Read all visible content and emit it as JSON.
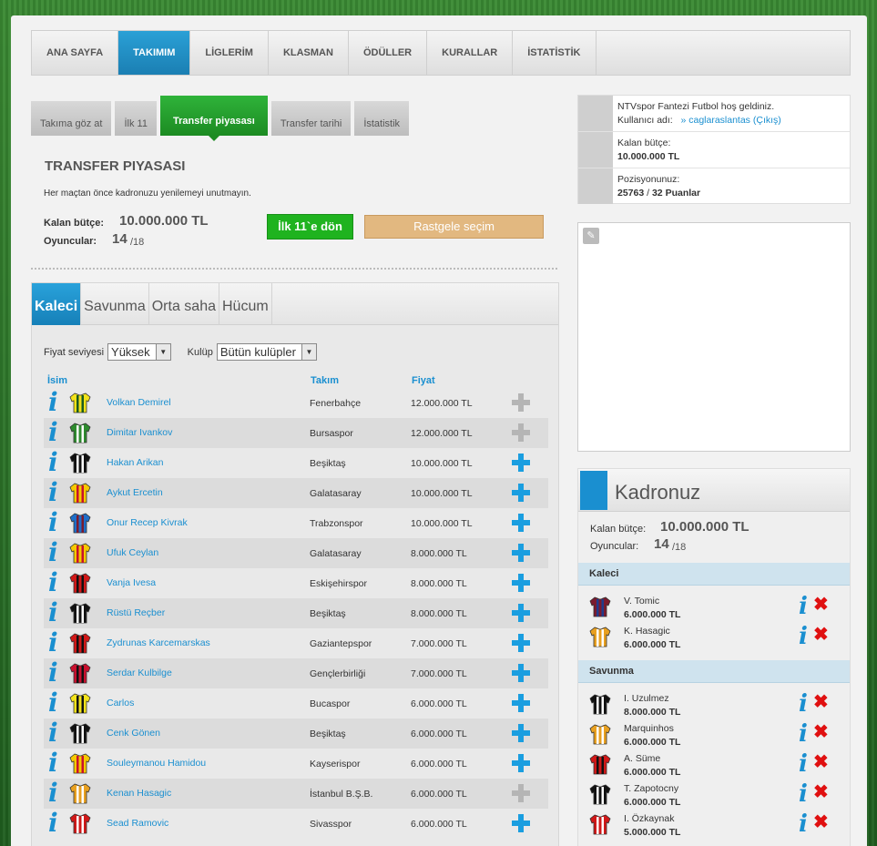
{
  "topnav": [
    "ANA SAYFA",
    "TAKIMIM",
    "LİGLERİM",
    "KLASMAN",
    "ÖDÜLLER",
    "KURALLAR",
    "İSTATİSTİK"
  ],
  "subnav": [
    "Takıma göz at",
    "İlk 11",
    "Transfer piyasası",
    "Transfer tarihi",
    "İstatistik"
  ],
  "header": {
    "title": "TRANSFER PIYASASI",
    "note": "Her maçtan önce kadronuzu yenilemeyi unutmayın.",
    "budget_label": "Kalan bütçe:",
    "budget_value": "10.000.000 TL",
    "players_label": "Oyuncular:",
    "players_value": "14",
    "players_max": "/18",
    "btn_first11": "İlk 11`e dön",
    "btn_random": "Rastgele seçim"
  },
  "position_tabs": [
    "Kaleci",
    "Savunma",
    "Orta saha",
    "Hücum"
  ],
  "filters": {
    "price_label": "Fiyat seviyesi",
    "price_value": "Yüksek",
    "club_label": "Kulüp",
    "club_value": "Bütün kulüpler"
  },
  "table": {
    "col_name": "İsim",
    "col_club": "Takım",
    "col_price": "Fiyat",
    "rows": [
      {
        "name": "Volkan Demirel",
        "club": "Fenerbahçe",
        "price": "12.000.000 TL",
        "avail": false,
        "c1": "#f2e21a",
        "c2": "#1a5a20"
      },
      {
        "name": "Dimitar Ivankov",
        "club": "Bursaspor",
        "price": "12.000.000 TL",
        "avail": false,
        "c1": "#2e8b2e",
        "c2": "#ffffff"
      },
      {
        "name": "Hakan Arikan",
        "club": "Beşiktaş",
        "price": "10.000.000 TL",
        "avail": true,
        "c1": "#111111",
        "c2": "#ffffff"
      },
      {
        "name": "Aykut Ercetin",
        "club": "Galatasaray",
        "price": "10.000.000 TL",
        "avail": true,
        "c1": "#f5c800",
        "c2": "#c8102e"
      },
      {
        "name": "Onur Recep Kivrak",
        "club": "Trabzonspor",
        "price": "10.000.000 TL",
        "avail": true,
        "c1": "#1e6ec8",
        "c2": "#7a1b2e"
      },
      {
        "name": "Ufuk Ceylan",
        "club": "Galatasaray",
        "price": "8.000.000 TL",
        "avail": true,
        "c1": "#f5c800",
        "c2": "#c8102e"
      },
      {
        "name": "Vanja Ivesa",
        "club": "Eskişehirspor",
        "price": "8.000.000 TL",
        "avail": true,
        "c1": "#d01818",
        "c2": "#111111"
      },
      {
        "name": "Rüstü Reçber",
        "club": "Beşiktaş",
        "price": "8.000.000 TL",
        "avail": true,
        "c1": "#111111",
        "c2": "#ffffff"
      },
      {
        "name": "Zydrunas Karcemarskas",
        "club": "Gaziantepspor",
        "price": "7.000.000 TL",
        "avail": true,
        "c1": "#d01818",
        "c2": "#111111"
      },
      {
        "name": "Serdar Kulbilge",
        "club": "Gençlerbirliği",
        "price": "7.000.000 TL",
        "avail": true,
        "c1": "#c8102e",
        "c2": "#111111"
      },
      {
        "name": "Carlos",
        "club": "Bucaspor",
        "price": "6.000.000 TL",
        "avail": true,
        "c1": "#f2e21a",
        "c2": "#111111"
      },
      {
        "name": "Cenk Gönen",
        "club": "Beşiktaş",
        "price": "6.000.000 TL",
        "avail": true,
        "c1": "#111111",
        "c2": "#ffffff"
      },
      {
        "name": "Souleymanou Hamidou",
        "club": "Kayserispor",
        "price": "6.000.000 TL",
        "avail": true,
        "c1": "#f5c800",
        "c2": "#c8102e"
      },
      {
        "name": "Kenan Hasagic",
        "club": "İstanbul B.Ş.B.",
        "price": "6.000.000 TL",
        "avail": false,
        "c1": "#e8a020",
        "c2": "#ffffff"
      },
      {
        "name": "Sead Ramovic",
        "club": "Sivasspor",
        "price": "6.000.000 TL",
        "avail": true,
        "c1": "#d01818",
        "c2": "#ffffff"
      }
    ]
  },
  "user": {
    "welcome": "NTVspor Fantezi Futbol hoş geldiniz.",
    "user_label": "Kullanıcı adı:",
    "username": "» caglaraslantas",
    "logout": "(Çıkış)",
    "budget_label": "Kalan bütçe:",
    "budget_value": "10.000.000 TL",
    "pos_label": "Pozisyonunuz:",
    "pos_value": "25763",
    "pos_sep": "/",
    "pos_points": "32 Puanlar"
  },
  "squad": {
    "title": "Kadronuz",
    "budget_label": "Kalan bütçe:",
    "budget_value": "10.000.000 TL",
    "players_label": "Oyuncular:",
    "players_value": "14",
    "players_max": "/18",
    "sec_gk": "Kaleci",
    "sec_def": "Savunma",
    "gk": [
      {
        "name": "V. Tomic",
        "price": "6.000.000 TL",
        "c1": "#7a1b2e",
        "c2": "#1e3c8c"
      },
      {
        "name": "K. Hasagic",
        "price": "6.000.000 TL",
        "c1": "#e8a020",
        "c2": "#ffffff"
      }
    ],
    "def": [
      {
        "name": "I. Uzulmez",
        "price": "8.000.000 TL",
        "c1": "#111111",
        "c2": "#ffffff"
      },
      {
        "name": "Marquinhos",
        "price": "6.000.000 TL",
        "c1": "#e8a020",
        "c2": "#ffffff"
      },
      {
        "name": "A. Süme",
        "price": "6.000.000 TL",
        "c1": "#d01818",
        "c2": "#111111"
      },
      {
        "name": "T. Zapotocny",
        "price": "6.000.000 TL",
        "c1": "#111111",
        "c2": "#ffffff"
      },
      {
        "name": "I. Özkaynak",
        "price": "5.000.000 TL",
        "c1": "#d01818",
        "c2": "#ffffff"
      }
    ]
  }
}
